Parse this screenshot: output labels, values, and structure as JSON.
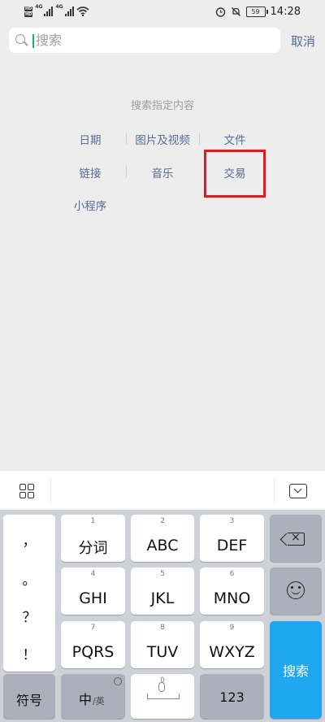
{
  "status_bar": {
    "sim1_label": "HD",
    "sim2_label": "HD",
    "net1": "4G",
    "net2": "4G",
    "battery": "59",
    "time": "14:28"
  },
  "search": {
    "placeholder": "搜索",
    "value": "",
    "cancel_label": "取消"
  },
  "panel": {
    "hint": "搜索指定内容",
    "categories": [
      "日期",
      "图片及视频",
      "文件",
      "链接",
      "音乐",
      "交易",
      "小程序"
    ]
  },
  "keyboard": {
    "punct": [
      "，",
      "。",
      "？",
      "！"
    ],
    "rows": [
      {
        "num": "1",
        "label": "分词"
      },
      {
        "num": "2",
        "label": "ABC"
      },
      {
        "num": "3",
        "label": "DEF"
      },
      {
        "num": "4",
        "label": "GHI"
      },
      {
        "num": "5",
        "label": "JKL"
      },
      {
        "num": "6",
        "label": "MNO"
      },
      {
        "num": "7",
        "label": "PQRS"
      },
      {
        "num": "8",
        "label": "TUV"
      },
      {
        "num": "9",
        "label": "WXYZ"
      }
    ],
    "symbols_label": "符号",
    "lang_main": "中",
    "lang_alt": "/英",
    "space_num": "0",
    "numbers_label": "123",
    "search_label": "搜索"
  },
  "colors": {
    "accent_link": "#576b95",
    "caret": "#07c160",
    "highlight": "#e3191f",
    "search_key": "#1fa8f0"
  },
  "icons": [
    "search-icon",
    "grid-icon",
    "collapse-keyboard-icon",
    "backspace-icon",
    "emoji-icon",
    "globe-icon",
    "microphone-icon"
  ]
}
